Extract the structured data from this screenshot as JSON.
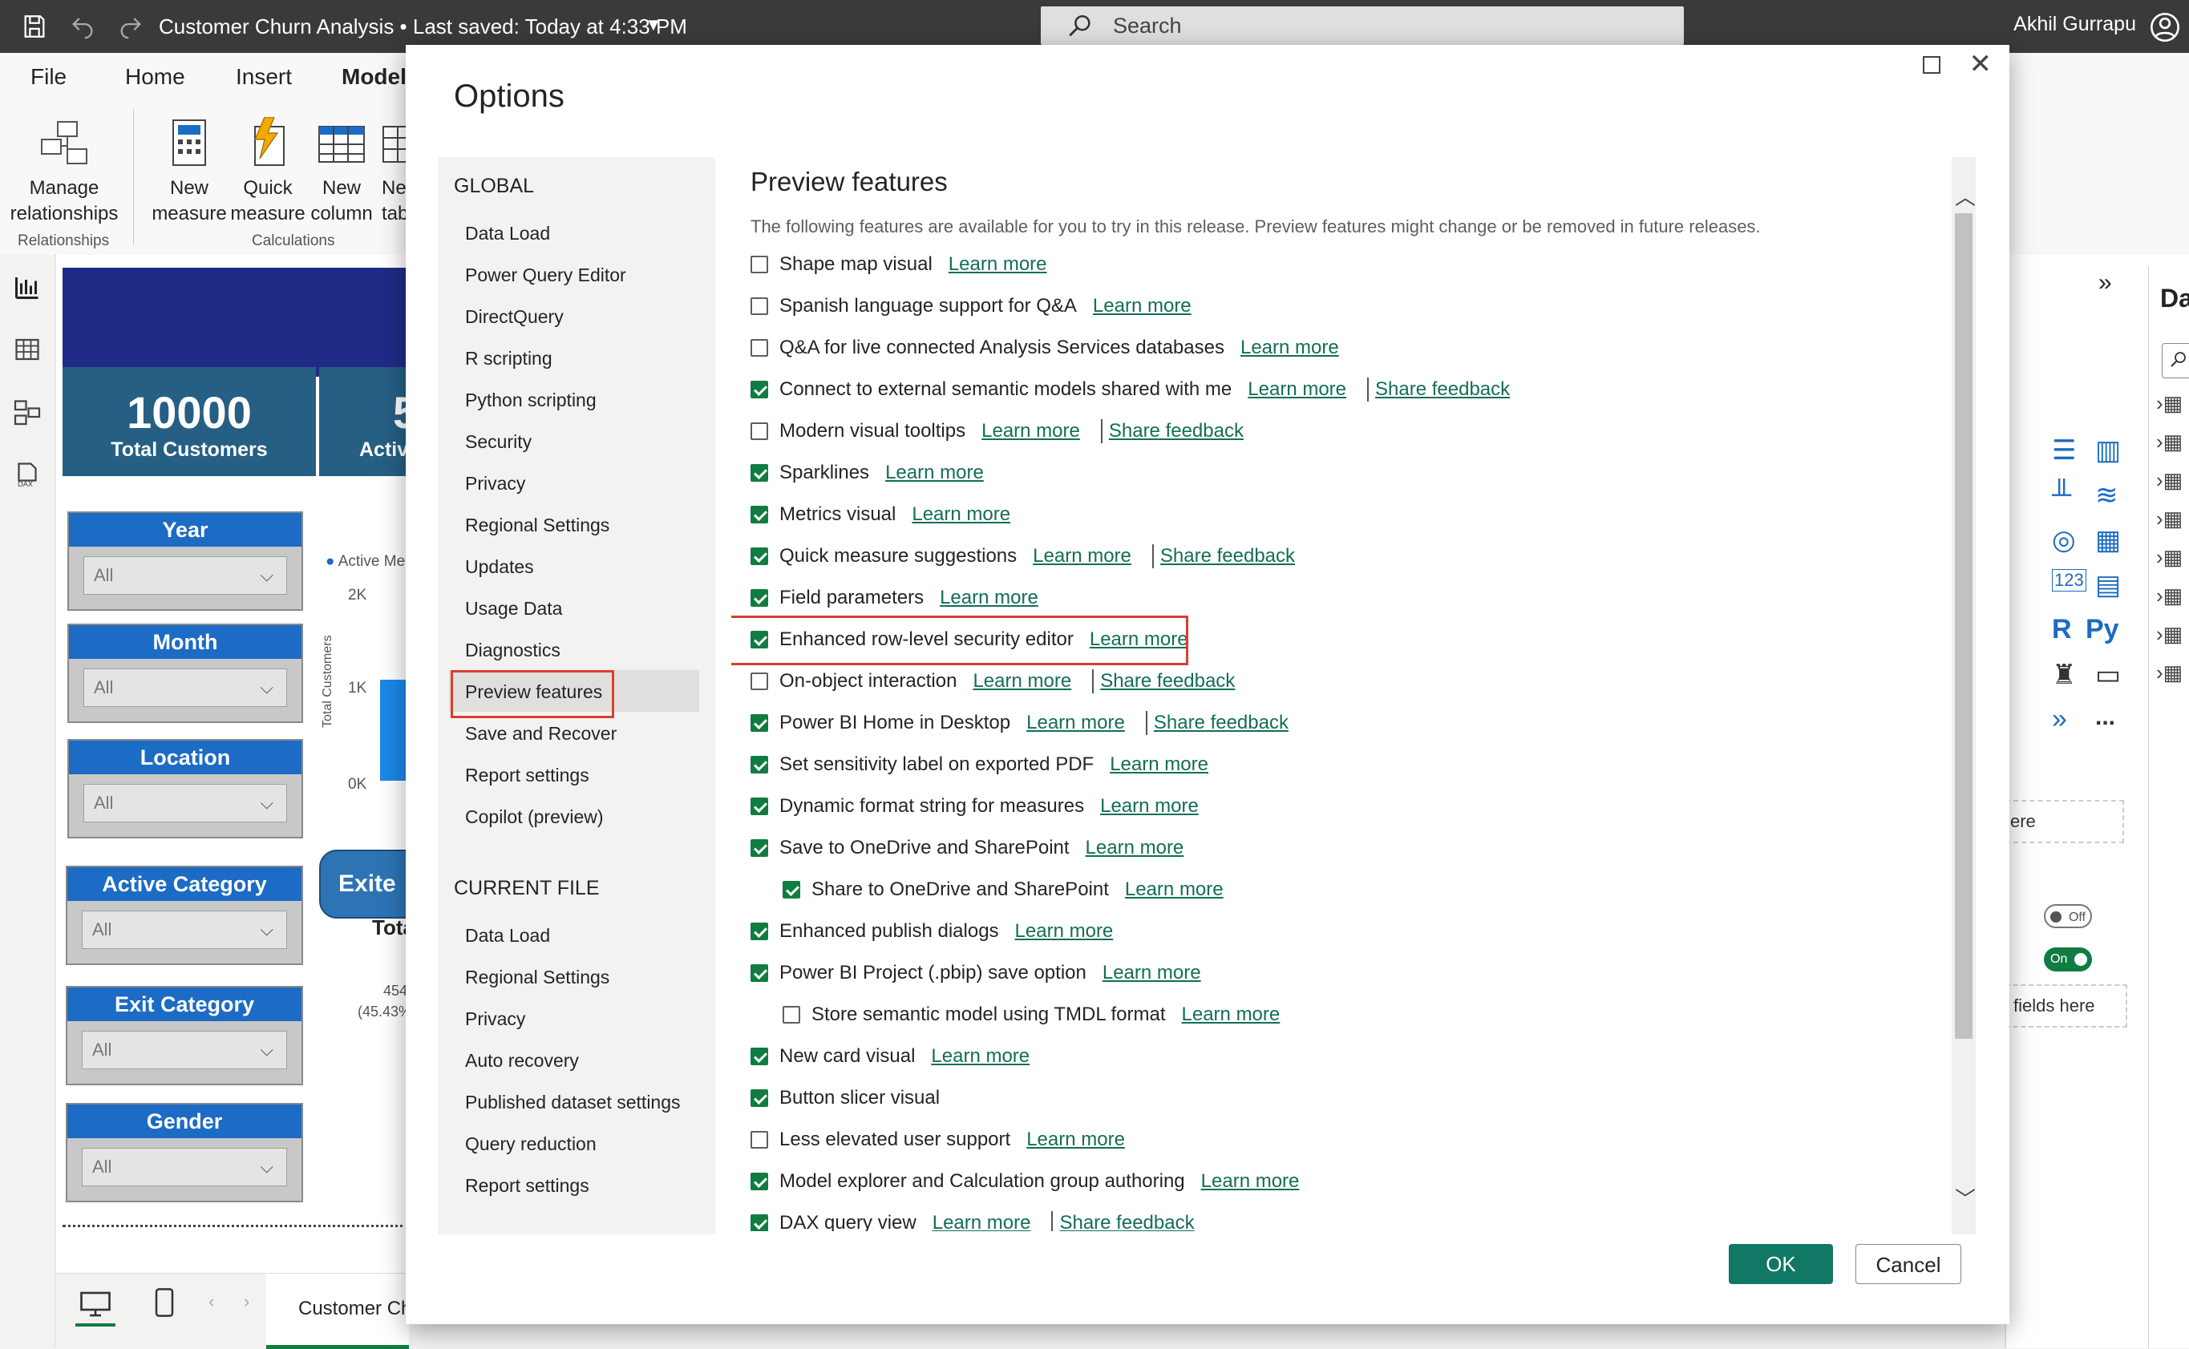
{
  "titlebar": {
    "title": "Customer Churn Analysis • Last saved: Today at 4:33 PM",
    "search_placeholder": "Search",
    "user": "Akhil Gurrapu"
  },
  "ribbon": {
    "tabs": [
      "File",
      "Home",
      "Insert",
      "Model"
    ],
    "buttons": {
      "manage_relationships": [
        "Manage",
        "relationships"
      ],
      "new_measure": [
        "New",
        "measure"
      ],
      "quick_measure": [
        "Quick",
        "measure"
      ],
      "new_column": [
        "New",
        "column"
      ],
      "new_table_partial": [
        "Ne",
        "tab"
      ]
    },
    "groups": {
      "relationships": "Relationships",
      "calculations": "Calculations"
    }
  },
  "canvas": {
    "kpi_value": "10000",
    "kpi_label": "Total Customers",
    "kpi2_value_partial": "5",
    "kpi2_label_partial": "Activ",
    "slicers": [
      {
        "title": "Year",
        "value": "All"
      },
      {
        "title": "Month",
        "value": "All"
      },
      {
        "title": "Location",
        "value": "All"
      },
      {
        "title": "Active Category",
        "value": "All"
      },
      {
        "title": "Exit Category",
        "value": "All"
      },
      {
        "title": "Gender",
        "value": "All"
      }
    ],
    "chart_legend_partial": "Active Me",
    "chart_ylabel": "Total Customers",
    "chart_ticks": [
      "2K",
      "1K",
      "0K"
    ],
    "exited_button_partial": "Exite",
    "exited_sub_partial": "Tota",
    "exited_value_partial": "454",
    "exited_pct_partial": "(45.43%",
    "page_tab_partial": "Customer Ch"
  },
  "rightpanel": {
    "title_partial": "Data",
    "drop_here_partial": "ere",
    "off_label": "Off",
    "on_label": "On",
    "fields_here_partial": "fields here",
    "r_label": "R",
    "py_label": "Py",
    "more_label": "..."
  },
  "dialog": {
    "title": "Options",
    "nav": {
      "global_header": "GLOBAL",
      "global_items": [
        "Data Load",
        "Power Query Editor",
        "DirectQuery",
        "R scripting",
        "Python scripting",
        "Security",
        "Privacy",
        "Regional Settings",
        "Updates",
        "Usage Data",
        "Diagnostics",
        "Preview features",
        "Save and Recover",
        "Report settings",
        "Copilot (preview)"
      ],
      "current_header": "CURRENT FILE",
      "current_items": [
        "Data Load",
        "Regional Settings",
        "Privacy",
        "Auto recovery",
        "Published dataset settings",
        "Query reduction",
        "Report settings"
      ]
    },
    "content": {
      "title": "Preview features",
      "description": "The following features are available for you to try in this release. Preview features might change or be removed in future releases.",
      "learn_more": "Learn more",
      "share_feedback": "Share feedback",
      "features": [
        {
          "label": "Shape map visual",
          "checked": false
        },
        {
          "label": "Spanish language support for Q&A",
          "checked": false
        },
        {
          "label": "Q&A for live connected Analysis Services databases",
          "checked": false
        },
        {
          "label": "Connect to external semantic models shared with me",
          "checked": true,
          "feedback": true
        },
        {
          "label": "Modern visual tooltips",
          "checked": false,
          "feedback": true
        },
        {
          "label": "Sparklines",
          "checked": true
        },
        {
          "label": "Metrics visual",
          "checked": true
        },
        {
          "label": "Quick measure suggestions",
          "checked": true,
          "feedback": true
        },
        {
          "label": "Field parameters",
          "checked": true
        },
        {
          "label": "Enhanced row-level security editor",
          "checked": true,
          "highlight": true
        },
        {
          "label": "On-object interaction",
          "checked": false,
          "feedback": true
        },
        {
          "label": "Power BI Home in Desktop",
          "checked": true,
          "feedback": true
        },
        {
          "label": "Set sensitivity label on exported PDF",
          "checked": true
        },
        {
          "label": "Dynamic format string for measures",
          "checked": true
        },
        {
          "label": "Save to OneDrive and SharePoint",
          "checked": true
        },
        {
          "label": "Share to OneDrive and SharePoint",
          "checked": true,
          "indent": true
        },
        {
          "label": "Enhanced publish dialogs",
          "checked": true
        },
        {
          "label": "Power BI Project (.pbip) save option",
          "checked": true
        },
        {
          "label": "Store semantic model using TMDL format",
          "checked": false,
          "indent": true
        },
        {
          "label": "New card visual",
          "checked": true
        },
        {
          "label": "Button slicer visual",
          "checked": true,
          "nolink": true
        },
        {
          "label": "Less elevated user support",
          "checked": false
        },
        {
          "label": "Model explorer and Calculation group authoring",
          "checked": true
        },
        {
          "label": "DAX query view",
          "checked": true,
          "feedback": true
        }
      ]
    },
    "ok": "OK",
    "cancel": "Cancel"
  }
}
